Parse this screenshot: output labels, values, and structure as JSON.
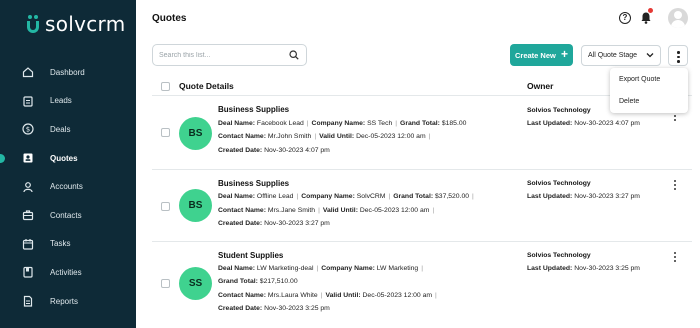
{
  "brand": {
    "name": "solvcrm"
  },
  "nav": [
    {
      "label": "Dashbord",
      "icon": "home-icon"
    },
    {
      "label": "Leads",
      "icon": "clipboard-icon"
    },
    {
      "label": "Deals",
      "icon": "dollar-icon"
    },
    {
      "label": "Quotes",
      "icon": "quote-icon",
      "active": true
    },
    {
      "label": "Accounts",
      "icon": "person-icon"
    },
    {
      "label": "Contacts",
      "icon": "briefcase-icon"
    },
    {
      "label": "Tasks",
      "icon": "calendar-icon"
    },
    {
      "label": "Activities",
      "icon": "book-icon"
    },
    {
      "label": "Reports",
      "icon": "document-icon"
    }
  ],
  "header": {
    "title": "Quotes"
  },
  "toolbar": {
    "search_placeholder": "Search this list...",
    "create_label": "Create New",
    "stage_label": "All Quote Stage"
  },
  "menu": {
    "items": [
      "Export Quote",
      "Delete"
    ]
  },
  "table": {
    "col_details": "Quote Details",
    "col_owner": "Owner"
  },
  "labels": {
    "deal_name": "Deal Name:",
    "company_name": "Company Name:",
    "grand_total": "Grand Total:",
    "contact_name": "Contact Name:",
    "valid_until": "Valid Until:",
    "created_date": "Created Date:",
    "last_updated": "Last Updated:"
  },
  "rows": [
    {
      "initials": "BS",
      "title": "Business Supplies",
      "deal_name": "Facebook Lead",
      "company_name": "SS Tech",
      "grand_total": "$185.00",
      "contact_name": "Mr.John Smith",
      "valid_until": "Dec-05-2023 12:00 am",
      "created_date": "Nov-30-2023 4:07 pm",
      "owner": "Solvios Technology",
      "last_updated": "Nov-30-2023 4:07 pm"
    },
    {
      "initials": "BS",
      "title": "Business Supplies",
      "deal_name": "Offline Lead",
      "company_name": "SolvCRM",
      "grand_total": "$37,520.00",
      "contact_name": "Mrs.Jane Smith",
      "valid_until": "Dec-05-2023 12:00 am",
      "created_date": "Nov-30-2023 3:27 pm",
      "owner": "Solvios Technology",
      "last_updated": "Nov-30-2023 3:27 pm"
    },
    {
      "initials": "SS",
      "title": "Student Supplies",
      "deal_name": "LW Marketing-deal",
      "company_name": "LW Marketing",
      "grand_total": "$217,510.00",
      "contact_name": "Mrs.Laura White",
      "valid_until": "Dec-05-2023 12:00 am",
      "created_date": "Nov-30-2023 3:25 pm",
      "owner": "Solvios Technology",
      "last_updated": "Nov-30-2023 3:25 pm"
    }
  ],
  "colors": {
    "sidebar": "#0e2a37",
    "accent": "#1fa79b",
    "avatar": "#3fd28f"
  }
}
